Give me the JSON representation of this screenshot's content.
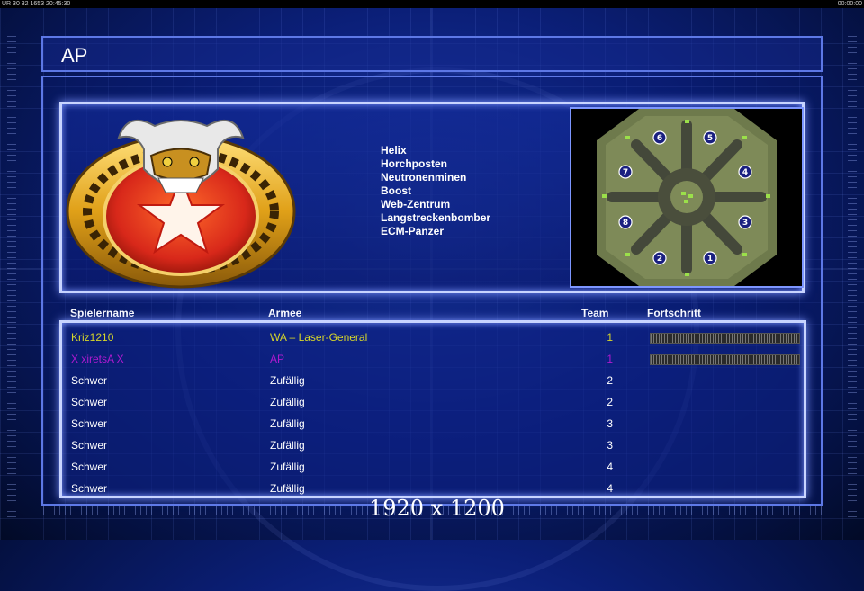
{
  "topbar": {
    "left": "UR 30 32 1653 20:45:30",
    "right": "00:00:00"
  },
  "title": "AP",
  "powers": [
    "Helix",
    "Horchposten",
    "Neutronenminen",
    "Boost",
    "Web-Zentrum",
    "Langstreckenbomber",
    "ECM-Panzer"
  ],
  "map": {
    "start_positions": [
      "1",
      "2",
      "3",
      "4",
      "5",
      "6",
      "7",
      "8"
    ]
  },
  "columns": {
    "name": "Spielername",
    "army": "Armee",
    "team": "Team",
    "progress": "Fortschritt"
  },
  "players": [
    {
      "name": "Kriz1210",
      "army": "WA – Laser-General",
      "team": "1",
      "color": "#d6d62a",
      "progress": 1
    },
    {
      "name": "X xiretsA X",
      "army": "AP",
      "team": "1",
      "color": "#b01ad0",
      "progress": 1
    },
    {
      "name": "Schwer",
      "army": "Zufällig",
      "team": "2",
      "color": "#ffffff"
    },
    {
      "name": "Schwer",
      "army": "Zufällig",
      "team": "2",
      "color": "#ffffff"
    },
    {
      "name": "Schwer",
      "army": "Zufällig",
      "team": "3",
      "color": "#ffffff"
    },
    {
      "name": "Schwer",
      "army": "Zufällig",
      "team": "3",
      "color": "#ffffff"
    },
    {
      "name": "Schwer",
      "army": "Zufällig",
      "team": "4",
      "color": "#ffffff"
    },
    {
      "name": "Schwer",
      "army": "Zufällig",
      "team": "4",
      "color": "#ffffff"
    }
  ],
  "resolution_label": "1920 x 1200",
  "colors": {
    "accent": "#5d78e6",
    "panel_glow": "#c8d4ff"
  }
}
